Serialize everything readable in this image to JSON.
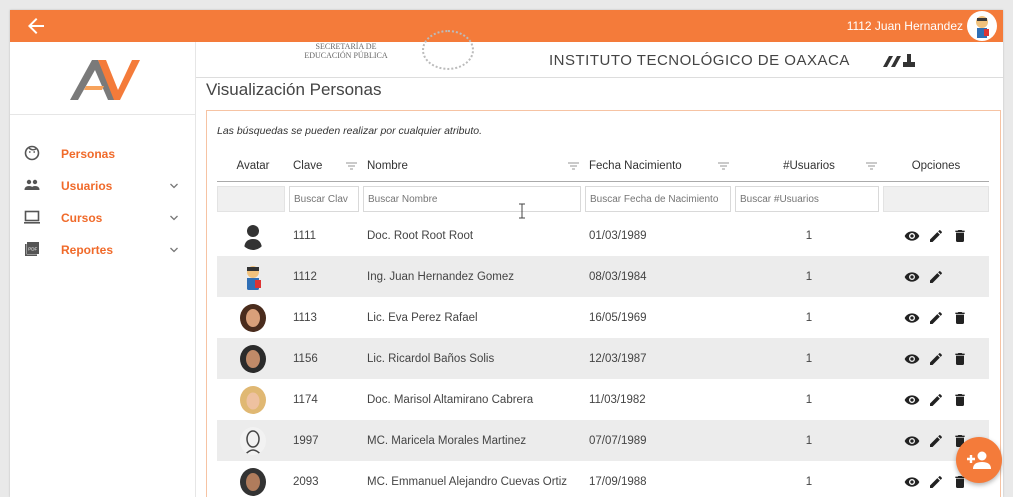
{
  "topbar": {
    "user_label": "1112 Juan Hernandez",
    "accent": "#f47b3a"
  },
  "banner": {
    "secretaria_line1": "SECRETARÍA DE",
    "secretaria_line2": "EDUCACIÓN PÚBLICA",
    "institute": "INSTITUTO TECNOLÓGICO DE OAXACA"
  },
  "sidebar": {
    "items": [
      {
        "label": "Personas",
        "icon": "face-icon"
      },
      {
        "label": "Usuarios",
        "icon": "people-icon"
      },
      {
        "label": "Cursos",
        "icon": "computer-icon"
      },
      {
        "label": "Reportes",
        "icon": "pdf-icon"
      }
    ]
  },
  "main": {
    "title": "Visualización Personas",
    "hint": "Las búsquedas se pueden realizar por cualquier atributo.",
    "columns": [
      "Avatar",
      "Clave",
      "Nombre",
      "Fecha Nacimiento",
      "#Usuarios",
      "Opciones"
    ],
    "filters": {
      "clave": "Buscar Clav",
      "nombre": "Buscar Nombre",
      "fecha": "Buscar Fecha de Nacimiento",
      "usuarios": "Buscar #Usuarios"
    },
    "rows": [
      {
        "clave": "1111",
        "nombre": "Doc. Root Root Root",
        "fecha": "01/03/1989",
        "usuarios": "1",
        "avatar": "silhouette",
        "delete": true
      },
      {
        "clave": "1112",
        "nombre": "Ing. Juan Hernandez Gomez",
        "fecha": "08/03/1984",
        "usuarios": "1",
        "avatar": "cartoon",
        "delete": false
      },
      {
        "clave": "1113",
        "nombre": "Lic. Eva Perez Rafael",
        "fecha": "16/05/1969",
        "usuarios": "1",
        "avatar": "woman",
        "delete": true
      },
      {
        "clave": "1156",
        "nombre": "Lic. Ricardol Baños Solis",
        "fecha": "12/03/1987",
        "usuarios": "1",
        "avatar": "man",
        "delete": true
      },
      {
        "clave": "1174",
        "nombre": "Doc. Marisol Altamirano Cabrera",
        "fecha": "11/03/1982",
        "usuarios": "1",
        "avatar": "blonde",
        "delete": true
      },
      {
        "clave": "1997",
        "nombre": "MC. Maricela Morales Martinez",
        "fecha": "07/07/1989",
        "usuarios": "1",
        "avatar": "sketch",
        "delete": true
      },
      {
        "clave": "2093",
        "nombre": "MC. Emmanuel Alejandro Cuevas Ortiz",
        "fecha": "17/09/1988",
        "usuarios": "1",
        "avatar": "man2",
        "delete": true
      }
    ]
  }
}
